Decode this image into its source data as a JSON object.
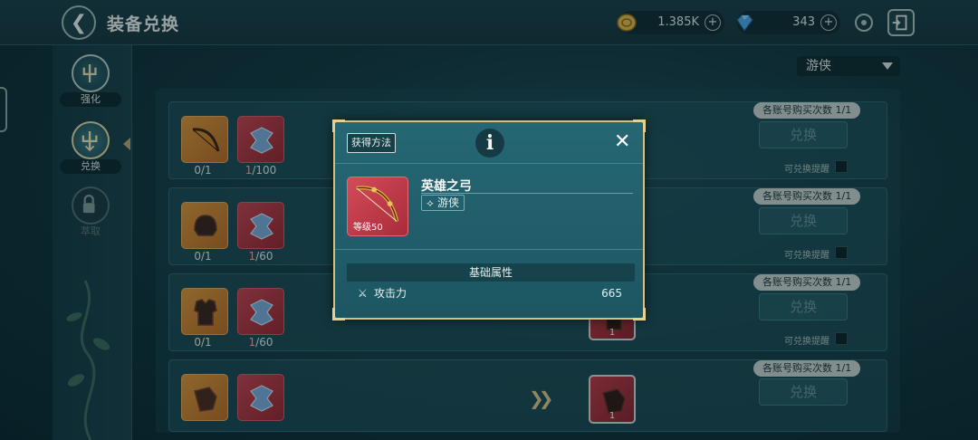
{
  "header": {
    "title": "装备兑换",
    "gold": "1.385K",
    "gems": "343"
  },
  "nav": {
    "items": [
      {
        "label": "强化",
        "state": "normal"
      },
      {
        "label": "兑换",
        "state": "active"
      },
      {
        "label": "萃取",
        "state": "locked"
      }
    ]
  },
  "filter": {
    "selected": "游侠"
  },
  "rows": [
    {
      "material_count": "0/1",
      "fragment_have": "1",
      "fragment_need": "/100",
      "limit": "各账号购买次数 1/1",
      "button": "兑换",
      "reminder": "可兑换提醒"
    },
    {
      "material_count": "0/1",
      "fragment_have": "1",
      "fragment_need": "/60",
      "limit": "各账号购买次数 1/1",
      "button": "兑换",
      "reminder": "可兑换提醒"
    },
    {
      "material_count": "0/1",
      "fragment_have": "1",
      "fragment_need": "/60",
      "result_count": "1",
      "limit": "各账号购买次数 1/1",
      "button": "兑换",
      "reminder": "可兑换提醒"
    },
    {
      "result_count": "1",
      "limit": "各账号购买次数 1/1",
      "button": "兑换"
    }
  ],
  "modal": {
    "obtain_label": "获得方法",
    "info_glyph": "i",
    "close_glyph": "✕",
    "item_name": "英雄之弓",
    "item_level": "等级50",
    "class_tag": "游侠",
    "attr_header": "基础属性",
    "attr_name": "攻击力",
    "attr_value": "665"
  },
  "colors": {
    "accent_gold": "#d8c07a",
    "rarity_red": "#c2424e",
    "rarity_orange": "#d8943c",
    "panel_teal": "#266774"
  },
  "icons": [
    "back-arrow-icon",
    "gold-coin-icon",
    "gem-icon",
    "plus-icon",
    "settings-icon",
    "exit-icon",
    "bow-icon",
    "helmet-icon",
    "armor-icon",
    "gauntlet-icon",
    "puzzle-fragment-icon",
    "lock-icon",
    "trident-icon",
    "info-icon",
    "close-icon",
    "attack-swords-icon",
    "ranger-class-icon"
  ]
}
